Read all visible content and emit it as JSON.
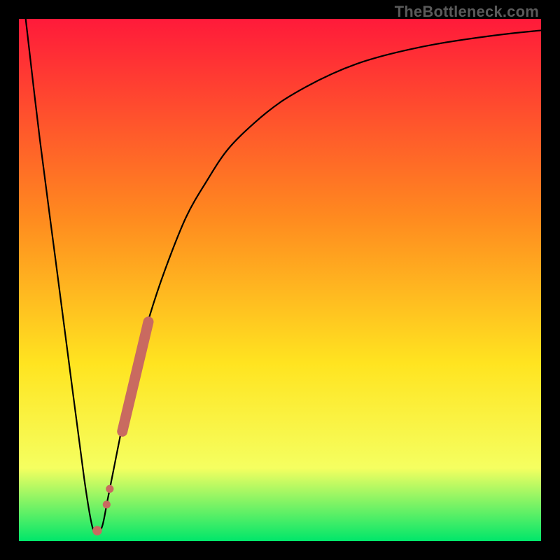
{
  "watermark": "TheBottleneck.com",
  "colors": {
    "frame": "#000000",
    "gradient_top": "#ff1a3a",
    "gradient_mid1": "#ff8a1f",
    "gradient_mid2": "#ffe420",
    "gradient_mid3": "#f5ff60",
    "gradient_bottom": "#00e66a",
    "curve": "#000000",
    "marker": "#c96a60"
  },
  "chart_data": {
    "type": "line",
    "title": "",
    "xlabel": "",
    "ylabel": "",
    "xlim": [
      0,
      100
    ],
    "ylim": [
      0,
      100
    ],
    "grid": false,
    "legend": false,
    "series": [
      {
        "name": "bottleneck-curve",
        "x": [
          1.3,
          4,
          7,
          10,
          12.5,
          14,
          15,
          16,
          17,
          18,
          20,
          22,
          25,
          28,
          32,
          36,
          40,
          45,
          50,
          55,
          60,
          65,
          70,
          75,
          80,
          85,
          90,
          95,
          100
        ],
        "y": [
          100,
          77,
          54,
          31,
          12,
          3,
          1.5,
          3,
          8,
          13,
          23,
          32,
          43,
          52,
          62,
          69,
          75,
          80,
          84,
          87,
          89.5,
          91.5,
          93,
          94.2,
          95.2,
          96,
          96.7,
          97.3,
          97.8
        ]
      }
    ],
    "markers": [
      {
        "shape": "circle",
        "x": 15.0,
        "y": 2.0,
        "r": 0.9
      },
      {
        "shape": "circle",
        "x": 16.8,
        "y": 7.0,
        "r": 0.75
      },
      {
        "shape": "circle",
        "x": 17.4,
        "y": 10.0,
        "r": 0.75
      },
      {
        "shape": "capsule",
        "x1": 19.8,
        "y1": 21.0,
        "x2": 24.8,
        "y2": 42.0,
        "w": 2.0
      }
    ]
  }
}
